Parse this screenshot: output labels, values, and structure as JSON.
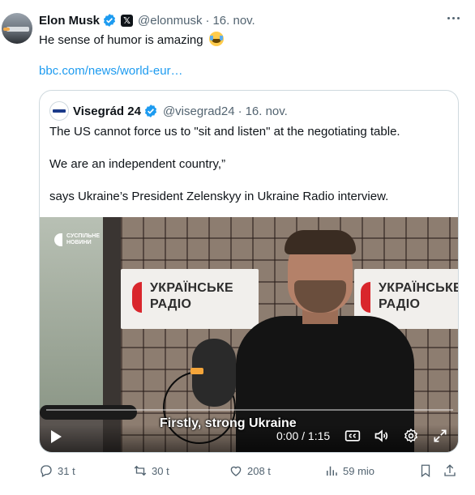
{
  "tweet": {
    "author_name": "Elon Musk",
    "author_handle": "@elonmusk",
    "separator": "·",
    "date": "16. nov.",
    "x_badge": "𝕏",
    "text": "He sense of humor is amazing",
    "emoji": "face-with-tears-of-joy",
    "link": "bbc.com/news/world-eur…"
  },
  "quote": {
    "author_name": "Visegrád 24",
    "author_handle": "@visegrad24",
    "separator": "·",
    "date": "16. nov.",
    "paragraphs": [
      "The US cannot force us to \"sit and listen\" at the negotiating table.",
      "We are an independent country,”",
      "says Ukraine’s President Zelenskyy in Ukraine Radio interview."
    ]
  },
  "video": {
    "brand_line1": "СУСПІЛЬНЕ",
    "brand_line2": "НОВИНИ",
    "sign_line1": "УКРАЇНСЬКЕ",
    "sign_line2": "РАДІО",
    "caption": "Firstly, strong Ukraine",
    "time": "0:00 / 1:15",
    "progress": 0.0
  },
  "actions": {
    "replies": "31 t",
    "reposts": "30 t",
    "likes": "208 t",
    "views": "59 mio"
  },
  "colors": {
    "accent": "#1d9bf0",
    "muted": "#536471",
    "text": "#0f1419",
    "border": "#cfd9de"
  }
}
